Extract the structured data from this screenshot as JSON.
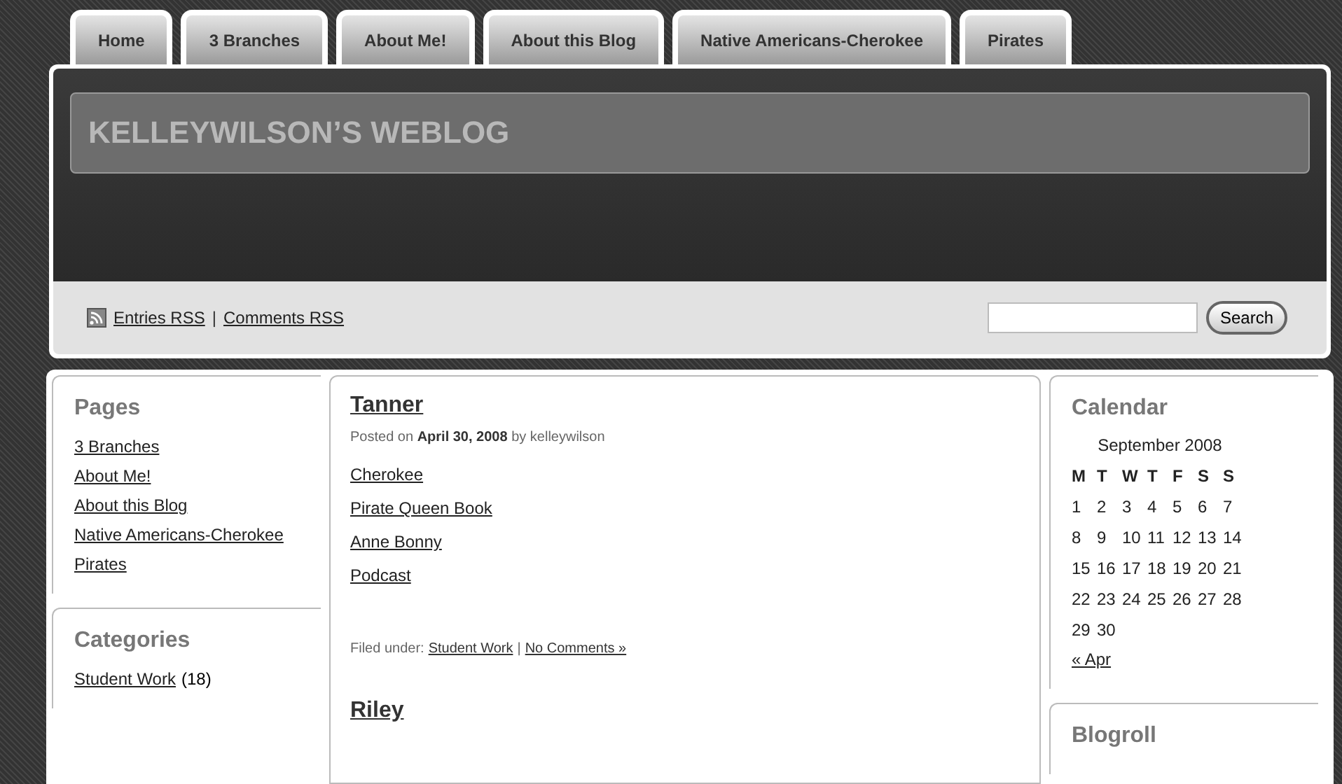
{
  "tabs": [
    {
      "label": "Home"
    },
    {
      "label": "3 Branches"
    },
    {
      "label": "About Me!"
    },
    {
      "label": "About this Blog"
    },
    {
      "label": "Native Americans-Cherokee"
    },
    {
      "label": "Pirates"
    }
  ],
  "header": {
    "title": "KELLEYWILSON’S WEBLOG"
  },
  "feeds": {
    "links": [
      "Entries RSS",
      "Comments RSS"
    ],
    "separator": "|"
  },
  "search": {
    "button": "Search"
  },
  "sidebar": {
    "pages_title": "Pages",
    "pages": [
      "3 Branches",
      "About Me!",
      "About this Blog",
      "Native Americans-Cherokee",
      "Pirates"
    ],
    "categories_title": "Categories",
    "categories": [
      {
        "name": "Student Work",
        "count": "(18)"
      }
    ]
  },
  "posts": [
    {
      "title": "Tanner",
      "meta": "Posted on **April 30, 2008** by kelleywilson",
      "links": [
        "Cherokee",
        "Pirate Queen Book",
        "Anne Bonny",
        "Podcast"
      ],
      "filed_label": "Filed under:",
      "category": "Student Work",
      "separator": "|",
      "comments": "No Comments »"
    },
    {
      "title": "Riley"
    }
  ],
  "calendar": {
    "title": "Calendar",
    "caption": "September 2008",
    "weekdays": [
      "M",
      "T",
      "W",
      "T",
      "F",
      "S",
      "S"
    ],
    "weeks": [
      [
        "1",
        "2",
        "3",
        "4",
        "5",
        "6",
        "7"
      ],
      [
        "8",
        "9",
        "10",
        "11",
        "12",
        "13",
        "14"
      ],
      [
        "15",
        "16",
        "17",
        "18",
        "19",
        "20",
        "21"
      ],
      [
        "22",
        "23",
        "24",
        "25",
        "26",
        "27",
        "28"
      ],
      [
        "29",
        "30"
      ]
    ],
    "prev": "« Apr"
  },
  "blogroll": {
    "title": "Blogroll"
  }
}
